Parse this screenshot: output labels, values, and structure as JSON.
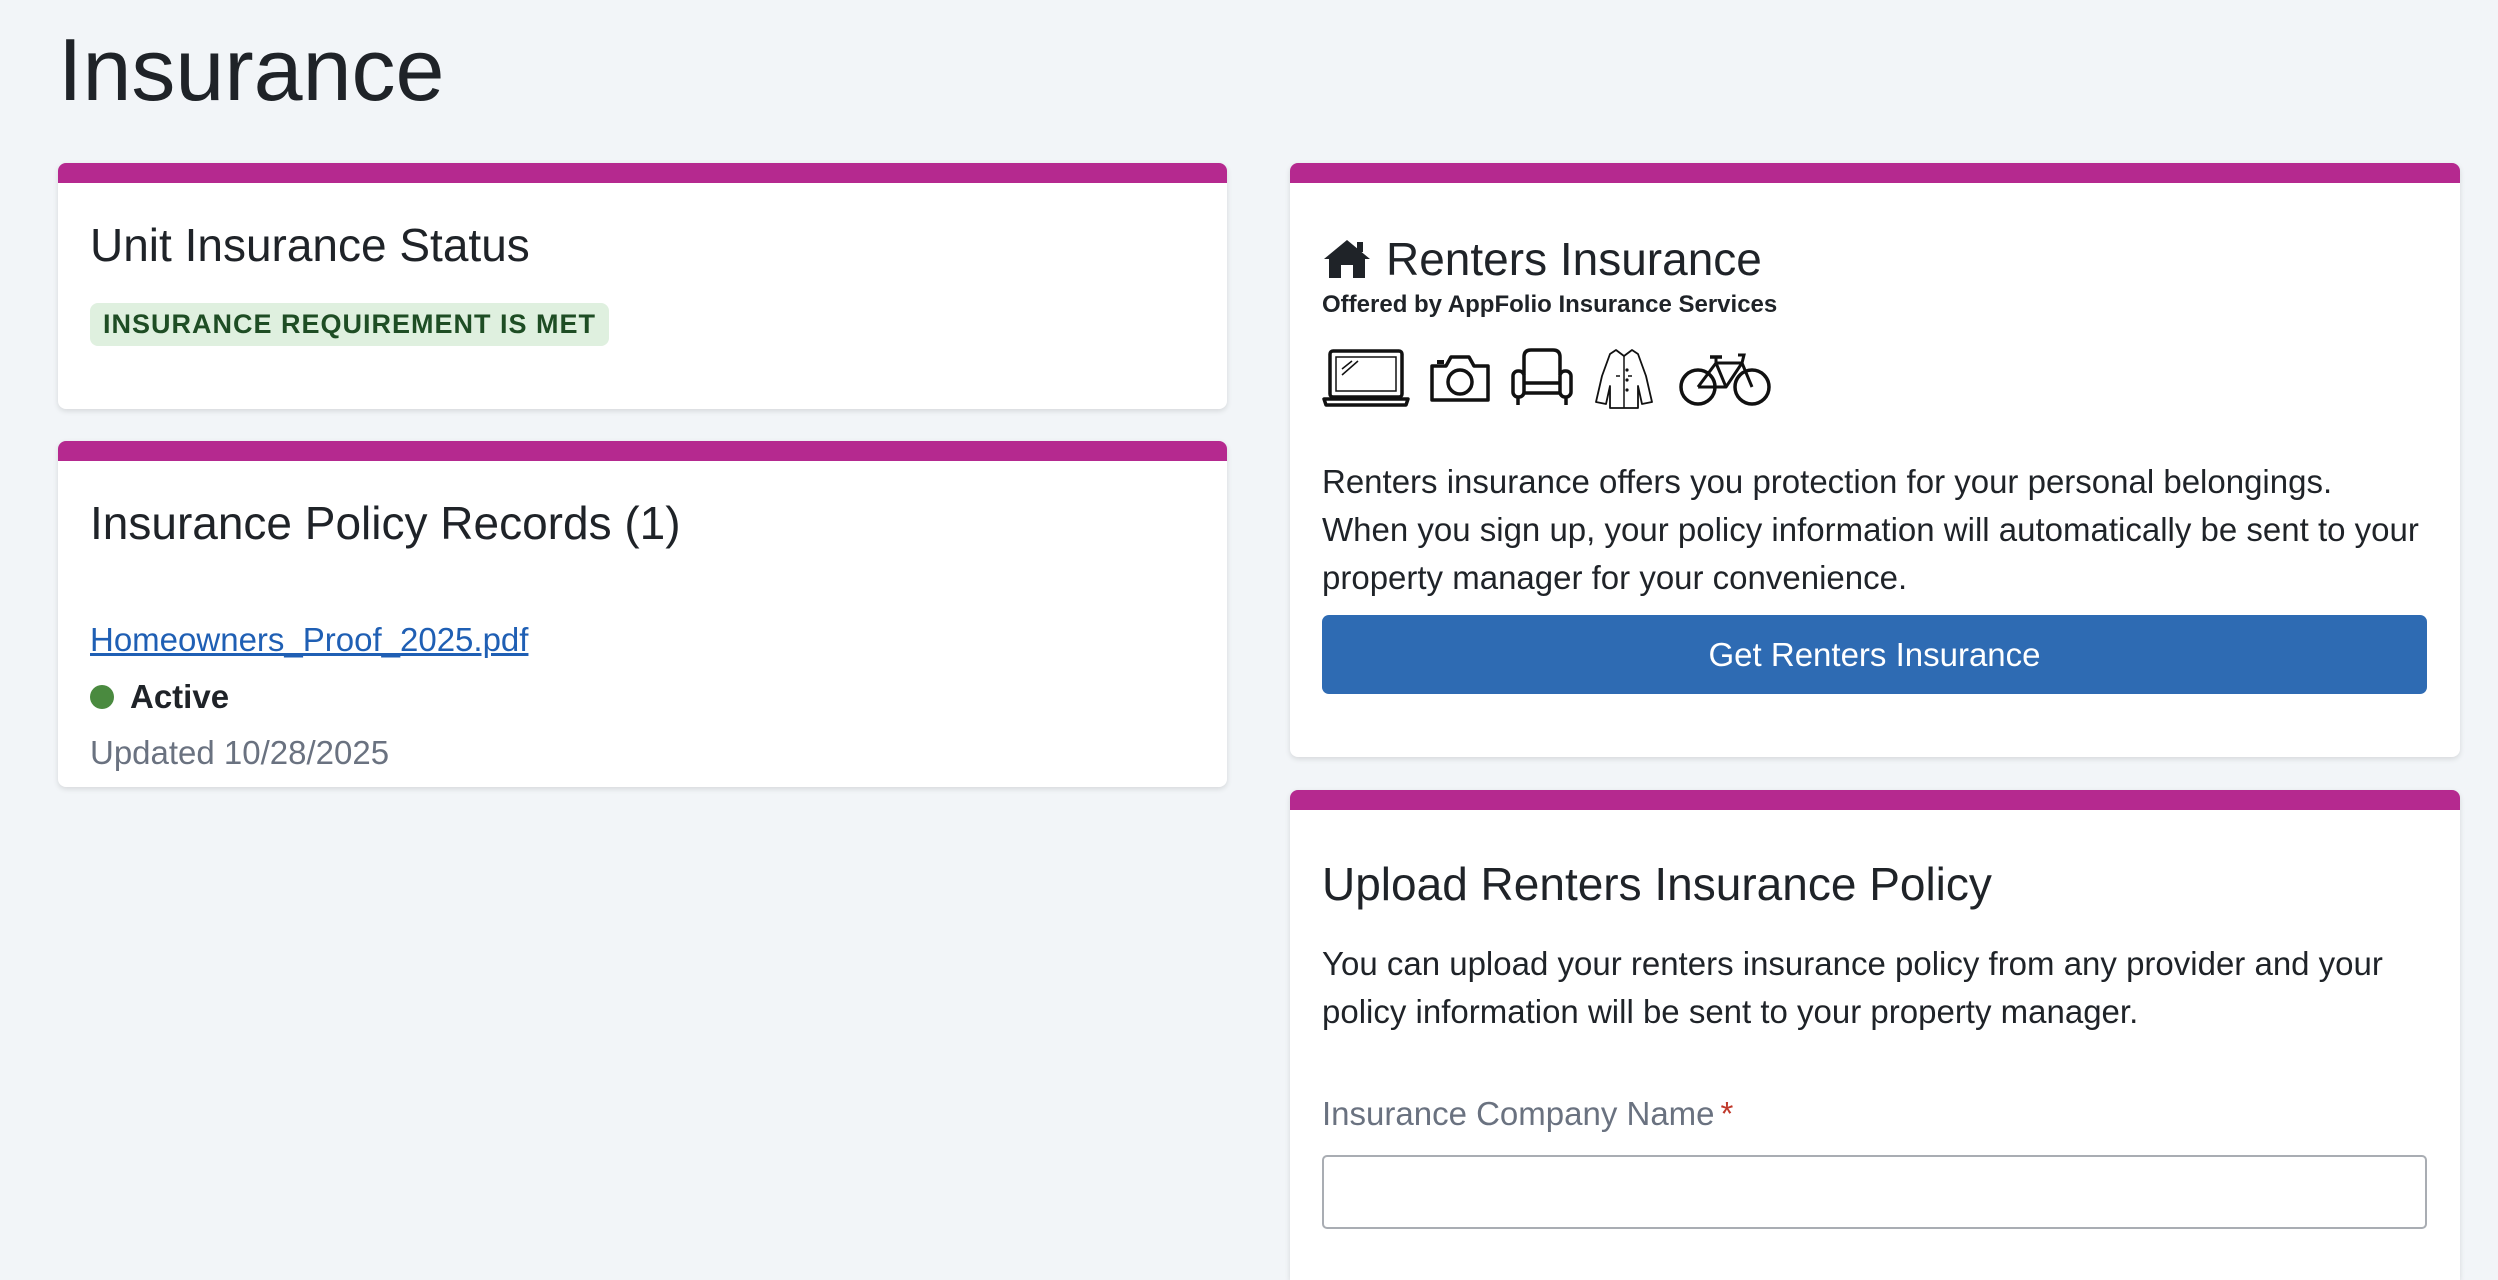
{
  "page": {
    "title": "Insurance"
  },
  "status_card": {
    "heading": "Unit Insurance Status",
    "badge": "INSURANCE REQUIREMENT IS MET",
    "accent_color": "#b5298f",
    "badge_bg": "#dff0df",
    "badge_text_color": "#1e4d24"
  },
  "records_card": {
    "heading": "Insurance Policy Records (1)",
    "records": [
      {
        "file_name": "Homeowners_Proof_2025.pdf",
        "status": "Active",
        "status_color": "#4a8a3f",
        "updated": "Updated 10/28/2025"
      }
    ]
  },
  "renters_card": {
    "heading": "Renters Insurance",
    "heading_icon": "house-icon",
    "subheading": "Offered by AppFolio Insurance Services",
    "belongings_icons": [
      "laptop-icon",
      "camera-icon",
      "armchair-icon",
      "coat-icon",
      "bicycle-icon"
    ],
    "description": "Renters insurance offers you protection for your personal belongings. When you sign up, your policy information will automatically be sent to your property manager for your convenience.",
    "button_label": "Get Renters Insurance",
    "button_color": "#2e6bb3"
  },
  "upload_card": {
    "heading": "Upload Renters Insurance Policy",
    "description": "You can upload your renters insurance policy from any provider and your policy information will be sent to your property manager.",
    "company_field": {
      "label": "Insurance Company Name",
      "required_marker": "*",
      "value": "",
      "placeholder": ""
    }
  }
}
